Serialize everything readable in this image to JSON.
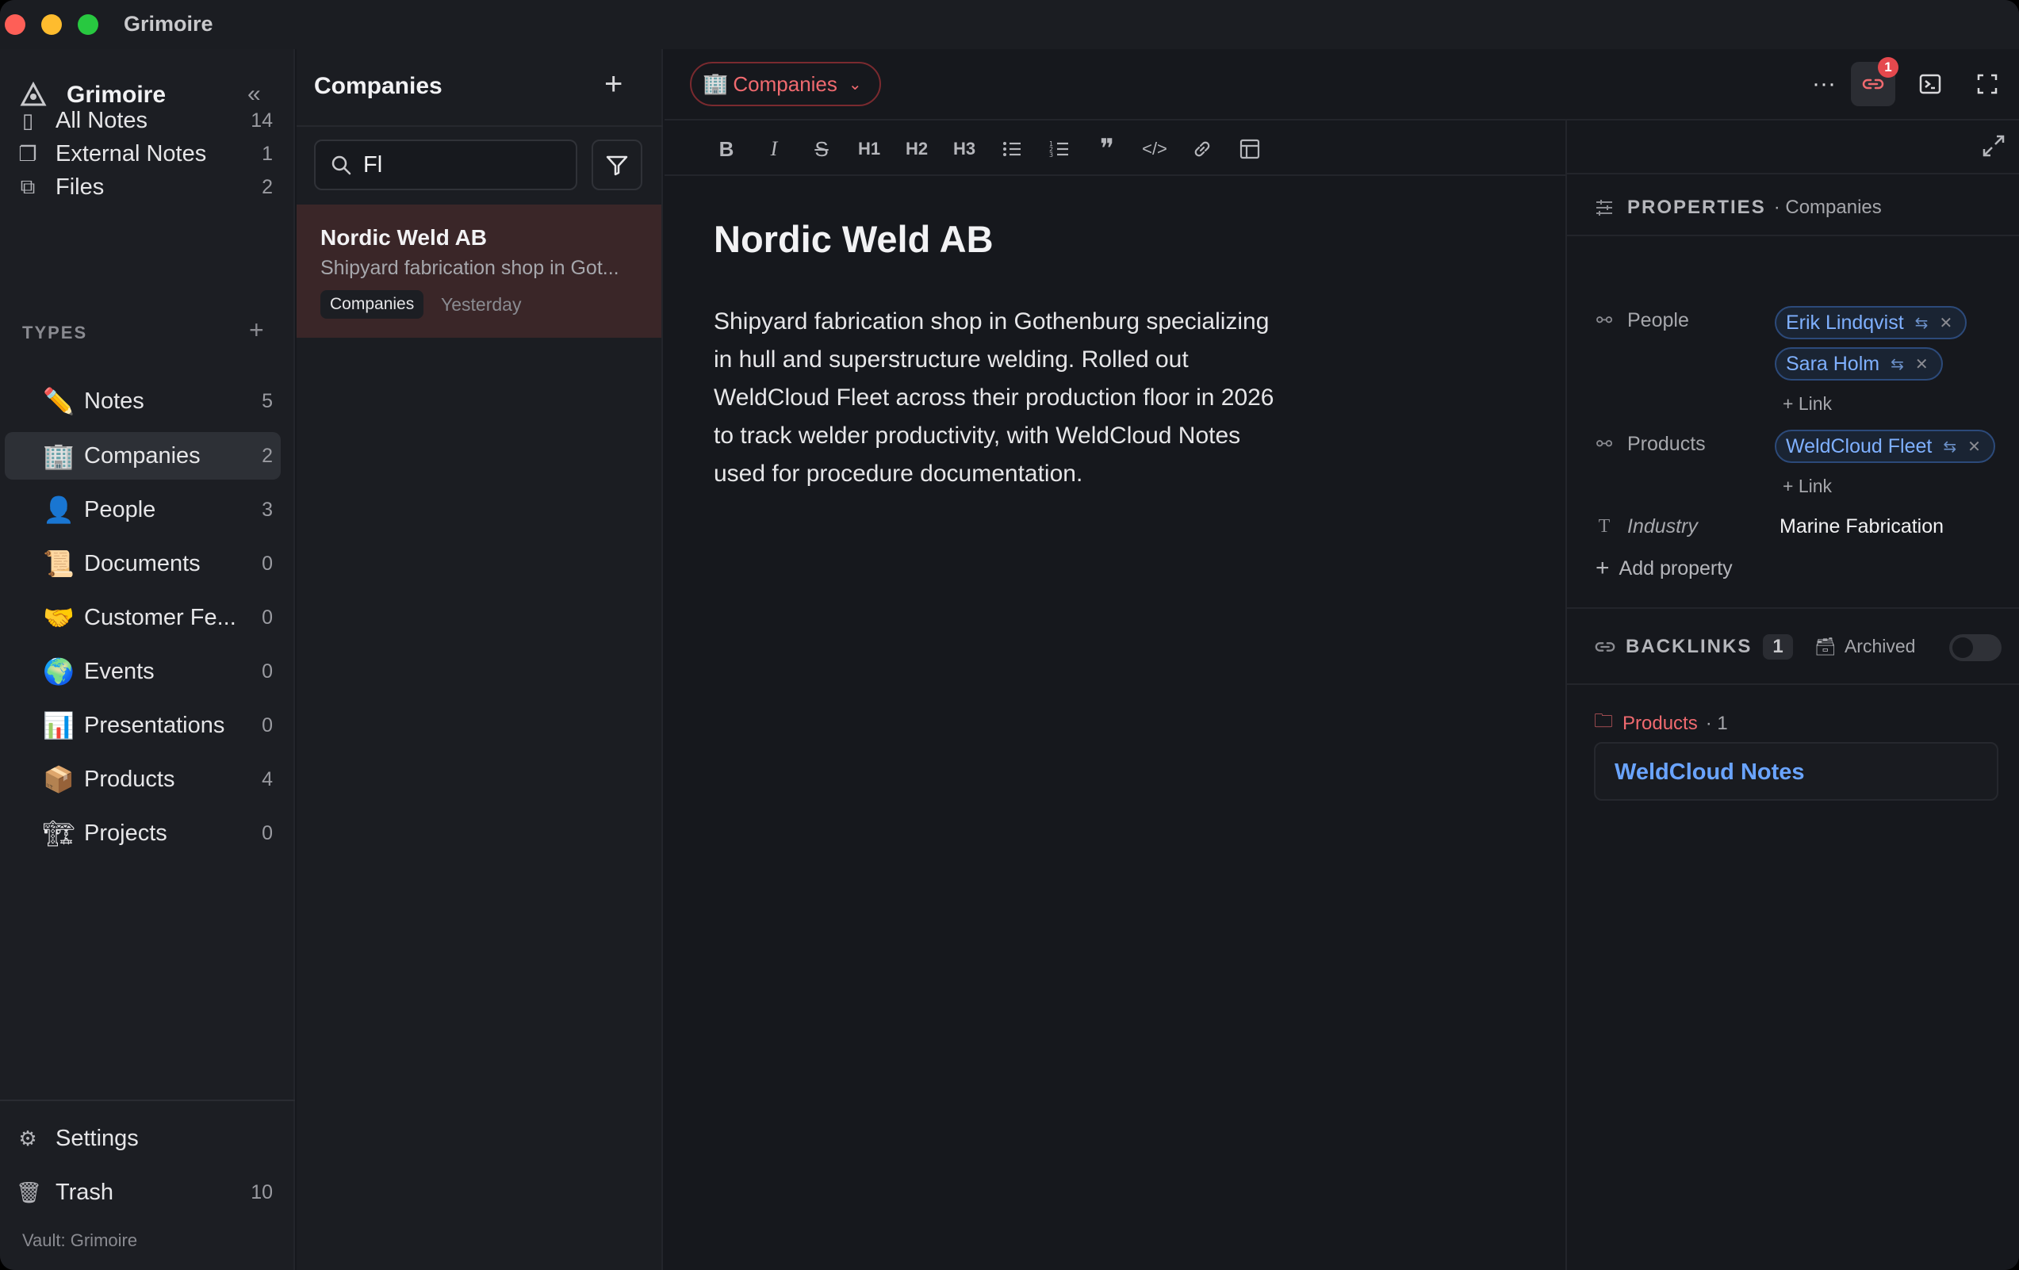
{
  "window": {
    "title": "Grimoire"
  },
  "sidebar": {
    "app_name": "Grimoire",
    "nav": [
      {
        "label": "All Notes",
        "count": "14",
        "icon": "notebook-icon"
      },
      {
        "label": "External Notes",
        "count": "1",
        "icon": "external-notes-icon"
      },
      {
        "label": "Files",
        "count": "2",
        "icon": "files-icon"
      }
    ],
    "types_heading": "TYPES",
    "types": [
      {
        "label": "Notes",
        "count": "5",
        "emoji": "✏️"
      },
      {
        "label": "Companies",
        "count": "2",
        "emoji": "🏢"
      },
      {
        "label": "People",
        "count": "3",
        "emoji": "👤"
      },
      {
        "label": "Documents",
        "count": "0",
        "emoji": "📜"
      },
      {
        "label": "Customer Fe...",
        "count": "0",
        "emoji": "🤝"
      },
      {
        "label": "Events",
        "count": "0",
        "emoji": "🌍"
      },
      {
        "label": "Presentations",
        "count": "0",
        "emoji": "📊"
      },
      {
        "label": "Products",
        "count": "4",
        "emoji": "📦"
      },
      {
        "label": "Projects",
        "count": "0",
        "emoji": "🏗"
      }
    ],
    "settings_label": "Settings",
    "trash_label": "Trash",
    "trash_count": "10",
    "vault_label": "Vault: Grimoire"
  },
  "note_list": {
    "title": "Companies",
    "search_value": "Fl",
    "notes": [
      {
        "title": "Nordic Weld AB",
        "snippet": "Shipyard fabrication shop in Got...",
        "type_badge": "Companies",
        "date": "Yesterday"
      }
    ]
  },
  "editor": {
    "type_pill_label": "Companies",
    "type_pill_emoji": "🏢",
    "backlink_badge": "1",
    "toolbar": {
      "h1": "H1",
      "h2": "H2",
      "h3": "H3"
    },
    "doc_title": "Nordic Weld AB",
    "doc_body": "Shipyard fabrication shop in Gothenburg specializing in hull and superstructure welding. Rolled out WeldCloud Fleet across their production floor in 2026 to track welder productivity, with WeldCloud Notes used for procedure documentation."
  },
  "properties": {
    "heading": "PROPERTIES",
    "type_name": "· Companies",
    "people_label": "People",
    "people": [
      "Erik Lindqvist",
      "Sara Holm"
    ],
    "products_label": "Products",
    "products": [
      "WeldCloud Fleet"
    ],
    "add_link_label": "+ Link",
    "industry_label": "Industry",
    "industry_value": "Marine Fabrication",
    "add_property_label": "Add property"
  },
  "backlinks": {
    "heading": "BACKLINKS",
    "count": "1",
    "archived_label": "Archived",
    "archived_on": false,
    "group_name": "Products",
    "group_count": "· 1",
    "items": [
      "WeldCloud Notes"
    ]
  },
  "colors": {
    "accent_red": "#f06a6f",
    "link_blue": "#6aa4ff",
    "chip_blue": "#7fb0ff",
    "selected_note_bg": "#3a2628"
  }
}
